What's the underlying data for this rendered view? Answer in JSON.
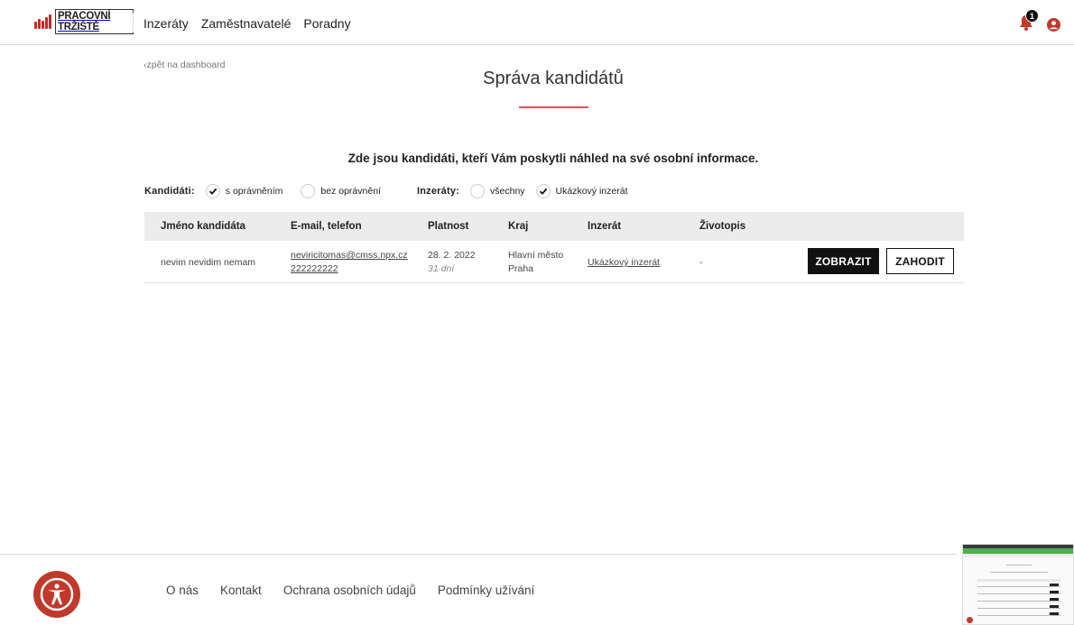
{
  "header": {
    "logo_text": "PRACOVNÍ TRŽIŠTĚ",
    "nav": [
      "Inzeráty",
      "Zaměstnavatelé",
      "Poradny"
    ],
    "notification_count": "1"
  },
  "main": {
    "back_link": "zpět na dashboard",
    "title": "Správa kandidátů",
    "intro": "Zde jsou kandidáti, kteří Vám poskytli náhled na své osobní informace.",
    "filters": {
      "candidates_label": "Kandidáti:",
      "candidates_options": [
        {
          "label": "s oprávněním",
          "checked": true
        },
        {
          "label": "bez oprávnění",
          "checked": false
        }
      ],
      "ads_label": "Inzeráty:",
      "ads_options": [
        {
          "label": "všechny",
          "checked": false
        },
        {
          "label": "Ukázkový inzerát",
          "checked": true
        }
      ]
    },
    "table": {
      "headers": [
        "Jméno kandidáta",
        "E-mail, telefon",
        "Platnost",
        "Kraj",
        "Inzerát",
        "Životopis"
      ],
      "rows": [
        {
          "name": "nevim nevidim nemam",
          "email": "neviricitomas@cmss.npx.cz",
          "phone": "222222222",
          "valid_date": "28. 2. 2022",
          "valid_days": "31 dní",
          "region_line1": "Hlavní město",
          "region_line2": "Praha",
          "ad": "Ukázkový inzerát",
          "cv": "-",
          "show_label": "ZOBRAZIT",
          "discard_label": "ZAHODIT"
        }
      ]
    }
  },
  "footer": {
    "links": [
      "O nás",
      "Kontakt",
      "Ochrana osobních údajů",
      "Podmínky užívání"
    ]
  },
  "colors": {
    "accent": "#d9534f",
    "brand_red": "#c0392b",
    "header_bg": "#ececec",
    "button_dark": "#111111"
  },
  "icons": {
    "bell": "bell-icon",
    "user": "user-circle-icon",
    "check": "check-icon",
    "accessibility": "accessibility-icon",
    "back": "chevron-left-icon"
  }
}
